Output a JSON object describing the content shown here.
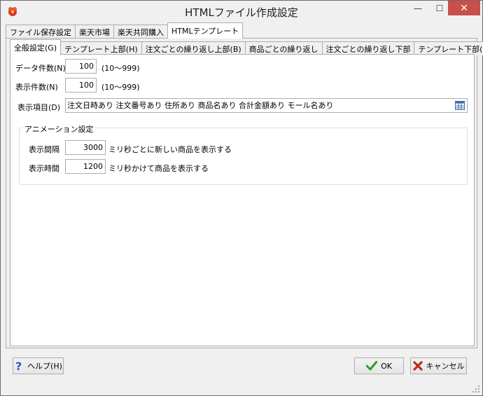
{
  "window": {
    "title": "HTMLファイル作成設定",
    "minimize": "—",
    "maximize": "☐",
    "close": "✕"
  },
  "outer_tabs": [
    {
      "label": "ファイル保存設定",
      "active": false
    },
    {
      "label": "楽天市場",
      "active": false
    },
    {
      "label": "楽天共同購入",
      "active": false
    },
    {
      "label": "HTMLテンプレート",
      "active": true
    }
  ],
  "inner_tabs": [
    {
      "label": "全般設定(G)",
      "active": true
    },
    {
      "label": "テンプレート上部(H)",
      "active": false
    },
    {
      "label": "注文ごとの繰り返し上部(B)",
      "active": false
    },
    {
      "label": "商品ごとの繰り返し",
      "active": false
    },
    {
      "label": "注文ごとの繰り返し下部",
      "active": false
    },
    {
      "label": "テンプレート下部(F)",
      "active": false
    }
  ],
  "general": {
    "data_count_label": "データ件数(N)",
    "data_count_value": "100",
    "data_count_range": "(10～999)",
    "display_count_label": "表示件数(N)",
    "display_count_value": "100",
    "display_count_range": "(10～999)",
    "display_items_label": "表示項目(D)",
    "display_items_value": "注文日時あり 注文番号あり 住所あり 商品名あり 合計金額あり モール名あり"
  },
  "animation": {
    "group_title": "アニメーション設定",
    "interval_label": "表示間隔",
    "interval_value": "3000",
    "interval_suffix": "ミリ秒ごとに新しい商品を表示する",
    "duration_label": "表示時間",
    "duration_value": "1200",
    "duration_suffix": "ミリ秒かけて商品を表示する"
  },
  "buttons": {
    "help": "ヘルプ(H)",
    "ok": "OK",
    "cancel": "キャンセル"
  },
  "colors": {
    "close_button": "#c7504a",
    "ok_icon": "#2e9a2e",
    "cancel_icon": "#c0281f",
    "help_icon": "#1f5fbf"
  }
}
